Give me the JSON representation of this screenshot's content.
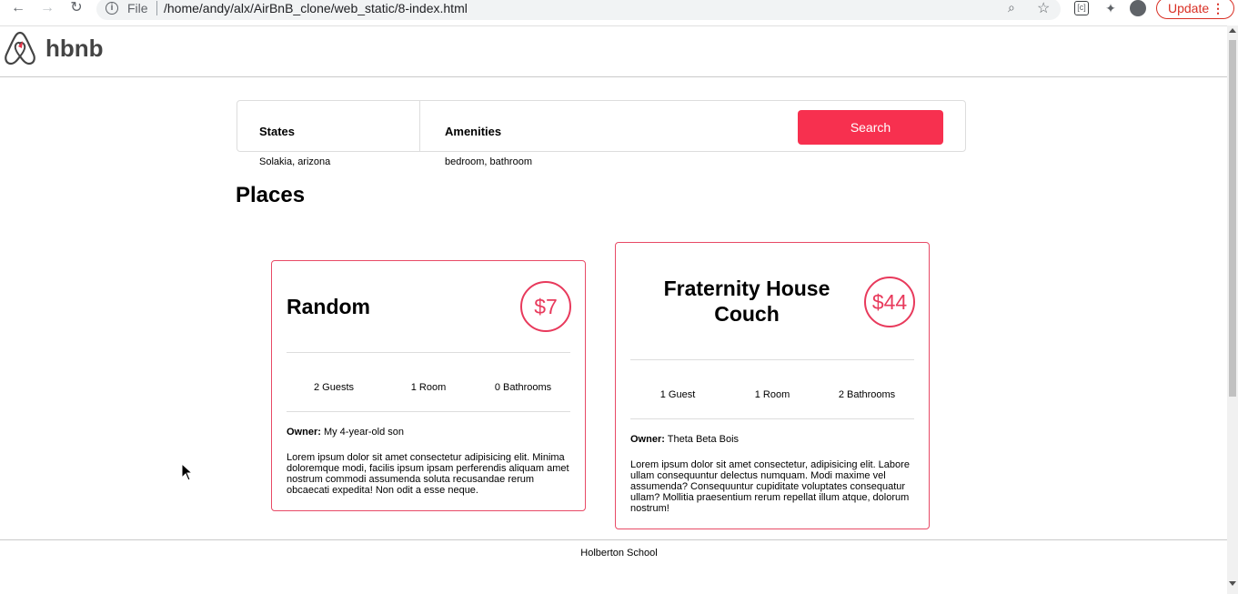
{
  "browser": {
    "scheme": "File",
    "url": "/home/andy/alx/AirBnB_clone/web_static/8-index.html",
    "update_label": "Update",
    "menu_glyph": "⋮"
  },
  "header": {
    "logo_text": "hbnb"
  },
  "filters": {
    "states_title": "States",
    "states_selected": "Solakia, arizona",
    "amenities_title": "Amenities",
    "amenities_selected": "bedroom, bathroom",
    "search_label": "Search"
  },
  "places_title": "Places",
  "places": [
    {
      "name": "Random",
      "price": "$7",
      "guests": "2 Guests",
      "rooms": "1 Room",
      "bathrooms": "0 Bathrooms",
      "owner_label": "Owner:",
      "owner": " My 4-year-old son",
      "description": "Lorem ipsum dolor sit amet consectetur adipisicing elit. Minima doloremque modi, facilis ipsum ipsam perferendis aliquam amet nostrum commodi assumenda soluta recusandae rerum obcaecati expedita! Non odit a esse neque."
    },
    {
      "name": "Fraternity House Couch",
      "price": "$44",
      "guests": "1 Guest",
      "rooms": "1 Room",
      "bathrooms": "2 Bathrooms",
      "owner_label": "Owner:",
      "owner": " Theta Beta Bois",
      "description": "Lorem ipsum dolor sit amet consectetur, adipisicing elit. Labore ullam consequuntur delectus numquam. Modi maxime vel assumenda? Consequuntur cupiditate voluptates consequatur ullam? Mollitia praesentium rerum repellat illum atque, dolorum nostrum!"
    }
  ],
  "footer": {
    "text": "Holberton School"
  },
  "colors": {
    "accent": "#e83a5c",
    "search_bg": "#f7304f"
  }
}
